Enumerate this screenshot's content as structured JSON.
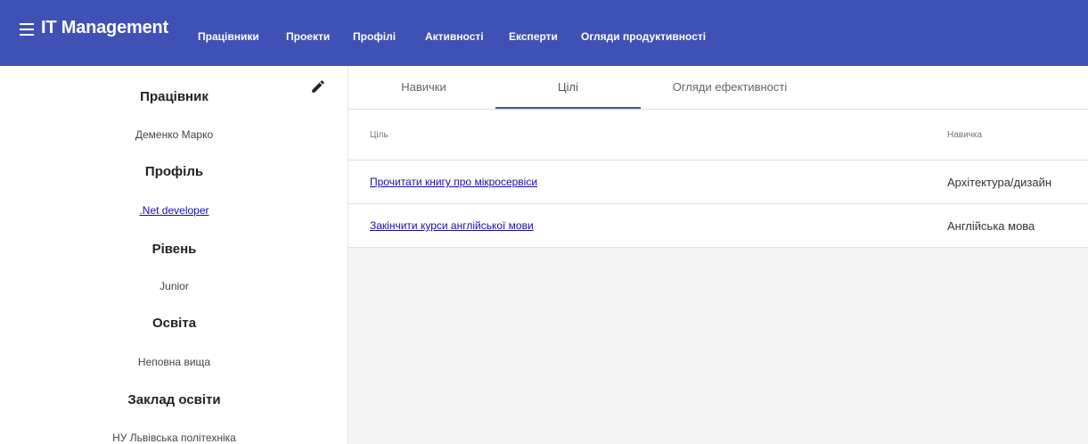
{
  "app": {
    "title": "IT Management",
    "nav": [
      "Працівники",
      "Проекти",
      "Профілі",
      "Активності",
      "Експерти",
      "Огляди продуктивності"
    ]
  },
  "side": {
    "employee_label": "Працівник",
    "employee_value": "Деменко Марко",
    "profile_label": "Профіль",
    "profile_value": ".Net developer",
    "level_label": "Рівень",
    "level_value": "Junior",
    "education_label": "Освіта",
    "education_value": "Неповна вища",
    "institution_label": "Заклад освіти",
    "institution_value": "НУ Львівська політехніка"
  },
  "tabs": [
    "Навички",
    "Цілі",
    "Огляди ефективності"
  ],
  "active_tab": "Цілі",
  "goals_table": {
    "columns": [
      "Ціль",
      "Навичка"
    ],
    "rows": [
      [
        "Прочитати книгу про мікросервіси",
        "Архітектура/дизайн"
      ],
      [
        "Закінчити курси англійської мови",
        "Англійська мова"
      ]
    ]
  },
  "colors": {
    "primary": "#3f51b5",
    "link": "#1a0dab",
    "content_bg": "#f5f5f5"
  },
  "icons": [
    "menu-icon",
    "edit-pencil-icon"
  ]
}
